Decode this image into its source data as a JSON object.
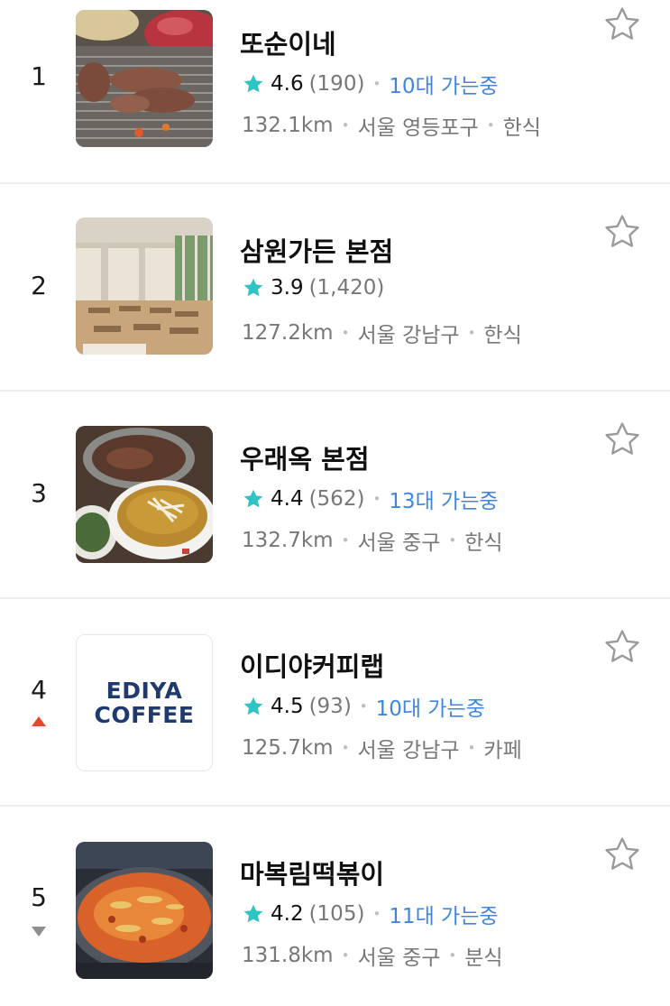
{
  "restaurants": [
    {
      "rank": "1",
      "trend": "",
      "name": "또순이네",
      "rating": "4.6",
      "reviews": "(190)",
      "visit": "10대 가는중",
      "distance": "132.1km",
      "area": "서울 영등포구",
      "category": "한식",
      "thumb": "grilled-meat"
    },
    {
      "rank": "2",
      "trend": "",
      "name": "삼원가든 본점",
      "rating": "3.9",
      "reviews": "(1,420)",
      "visit": "",
      "distance": "127.2km",
      "area": "서울 강남구",
      "category": "한식",
      "thumb": "dining-hall"
    },
    {
      "rank": "3",
      "trend": "",
      "name": "우래옥 본점",
      "rating": "4.4",
      "reviews": "(562)",
      "visit": "13대 가는중",
      "distance": "132.7km",
      "area": "서울 중구",
      "category": "한식",
      "thumb": "soup-bowl"
    },
    {
      "rank": "4",
      "trend": "up",
      "name": "이디야커피랩",
      "rating": "4.5",
      "reviews": "(93)",
      "visit": "10대 가는중",
      "distance": "125.7km",
      "area": "서울 강남구",
      "category": "카페",
      "thumb": "logo",
      "logo_line1": "EDIYA",
      "logo_line2": "COFFEE"
    },
    {
      "rank": "5",
      "trend": "down",
      "name": "마복림떡볶이",
      "rating": "4.2",
      "reviews": "(105)",
      "visit": "11대 가는중",
      "distance": "131.8km",
      "area": "서울 중구",
      "category": "분식",
      "thumb": "tteokbokki-pot"
    }
  ],
  "colors": {
    "star": "#2ec4c4",
    "visit": "#3f86e0",
    "trend_up": "#e5472f",
    "trend_down": "#8e8e8e",
    "logo_text": "#1f3a6e"
  }
}
